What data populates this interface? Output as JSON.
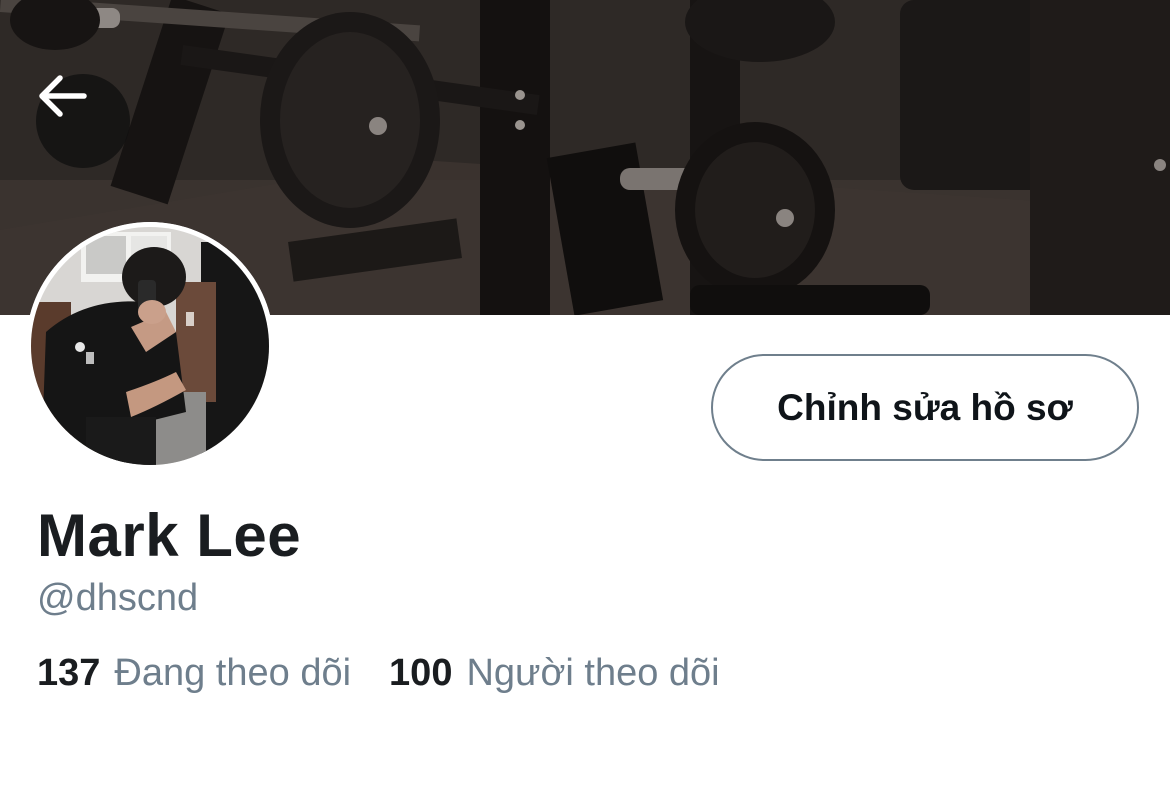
{
  "header": {
    "back_icon": "arrow-left-icon",
    "banner_image": "gym-weights-dark-photo"
  },
  "profile": {
    "avatar_image": "mirror-selfie-photo",
    "display_name": "Mark Lee",
    "handle": "@dhscnd",
    "edit_button_label": "Chỉnh sửa hồ sơ",
    "following": {
      "count": "137",
      "label": "Đang theo dõi"
    },
    "followers": {
      "count": "100",
      "label": "Người theo dõi"
    }
  },
  "colors": {
    "text_primary": "#1a1d20",
    "text_secondary": "#6e7e8c",
    "button_border": "#6f7f8c",
    "background": "#ffffff"
  }
}
